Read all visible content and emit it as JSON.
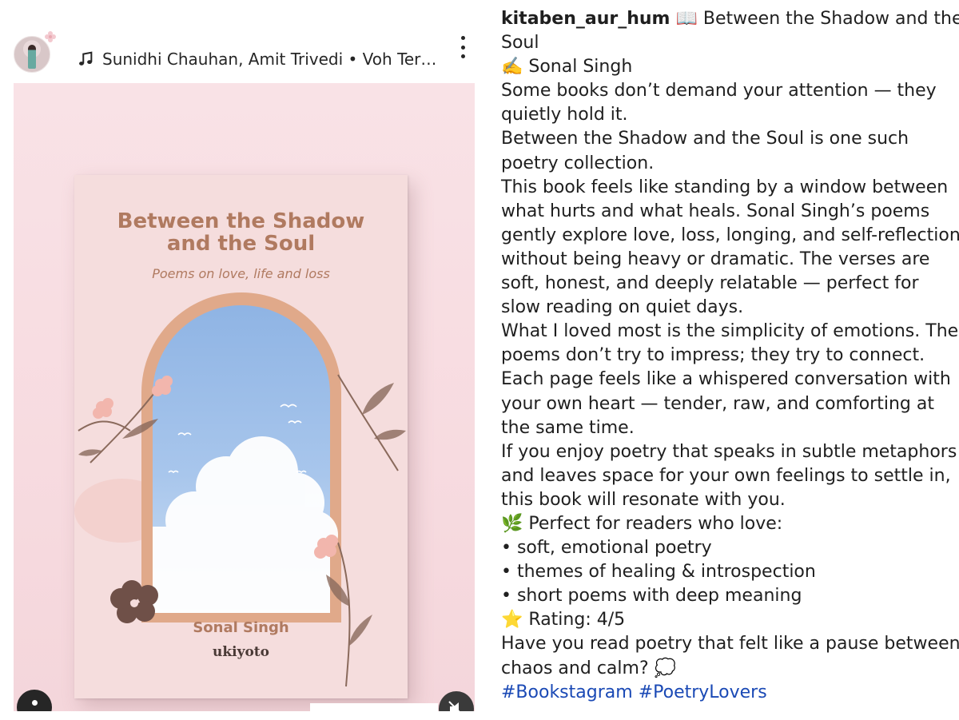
{
  "post": {
    "music_label": "Sunidhi Chauhan, Amit Trivedi • Voh Ter…",
    "book": {
      "title_line1": "Between the Shadow",
      "title_line2": "and the Soul",
      "subtitle": "Poems on love, life and loss",
      "author": "Sonal Singh",
      "publisher": "ukiyoto"
    }
  },
  "caption": {
    "username": "kitaben_aur_hum",
    "title_emoji": "📖",
    "line1_rest": " Between the Shadow and the",
    "line2": "Soul",
    "line3": "✍️ Sonal Singh",
    "lines": [
      "Some books don’t demand your attention — they",
      "quietly hold it.",
      "Between the Shadow and the Soul is one such",
      "poetry collection.",
      "This book feels like standing by a window between",
      "what hurts and what heals. Sonal Singh’s poems",
      "gently explore love, loss, longing, and self-reflection",
      "without being heavy or dramatic. The verses are",
      "soft, honest, and deeply relatable — perfect for",
      "slow reading on quiet days.",
      "What I loved most is the simplicity of emotions. The",
      "poems don’t try to impress; they try to connect.",
      "Each page feels like a whispered conversation with",
      "your own heart — tender, raw, and comforting at",
      "the same time.",
      "If you enjoy poetry that speaks in subtle metaphors",
      "and leaves space for your own feelings to settle in,",
      "this book will resonate with you.",
      "🌿 Perfect for readers who love:",
      "• soft, emotional poetry",
      "• themes of healing & introspection",
      "• short poems with deep meaning",
      "⭐ Rating: 4/5",
      "Have you read poetry that felt like a pause between",
      "chaos and calm? 💭"
    ],
    "hashtags": [
      "#Bookstagram",
      "#PoetryLovers"
    ]
  },
  "colors": {
    "hashtag": "#1a49b5",
    "cover_text": "#b07a60",
    "background_pink": "#f7dbe0"
  }
}
